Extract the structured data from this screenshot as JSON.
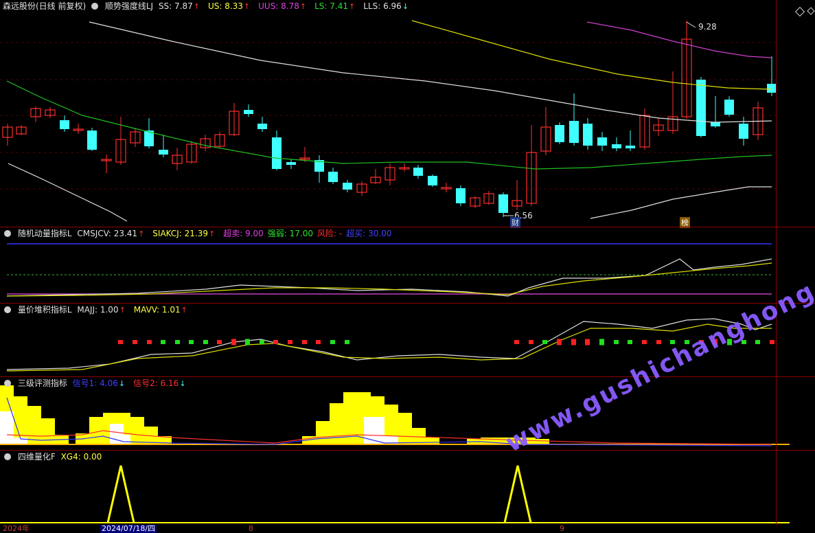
{
  "main": {
    "stock": "森远股份(日线 前复权)",
    "indicator": "顺势强度线LJ",
    "values": [
      {
        "label": "SS: 7.87",
        "arrow": "↑",
        "color": "#e0e0e0",
        "arrow_color": "#ff3030"
      },
      {
        "label": "US: 8.33",
        "arrow": "↑",
        "color": "#ffff40",
        "arrow_color": "#ff3030"
      },
      {
        "label": "UUS: 8.78",
        "arrow": "↑",
        "color": "#e040e0",
        "arrow_color": "#ff3030"
      },
      {
        "label": "LS: 7.41",
        "arrow": "↑",
        "color": "#30e030",
        "arrow_color": "#ff3030"
      },
      {
        "label": "LLS: 6.96",
        "arrow": "↓",
        "color": "#e0e0e0",
        "arrow_color": "#40ffff"
      }
    ],
    "high_label": "9.28",
    "low_label": "6.56",
    "tag_cai": "财",
    "tag_bang": "榜"
  },
  "p2": {
    "name": "随机动量指标L",
    "values": [
      {
        "label": "CMSJCV: 23.41",
        "arrow": "↑",
        "color": "#e0e0e0",
        "arrow_color": "#ff3030"
      },
      {
        "label": "SIAKCJ: 21.39",
        "arrow": "↑",
        "color": "#ffff40",
        "arrow_color": "#ff3030"
      },
      {
        "label": "超卖: 9.00",
        "arrow": "",
        "color": "#e040e0",
        "arrow_color": ""
      },
      {
        "label": "强弱: 17.00",
        "arrow": "",
        "color": "#30e030",
        "arrow_color": ""
      },
      {
        "label": "风险: -",
        "arrow": "",
        "color": "#ff3030",
        "arrow_color": ""
      },
      {
        "label": "超买: 30.00",
        "arrow": "",
        "color": "#4040ff",
        "arrow_color": ""
      }
    ]
  },
  "p3": {
    "name": "量价堆积指标L",
    "values": [
      {
        "label": "MAJJ: 1.00",
        "arrow": "↑",
        "color": "#e0e0e0",
        "arrow_color": "#ff3030"
      },
      {
        "label": "MAVV: 1.01",
        "arrow": "↑",
        "color": "#ffff40",
        "arrow_color": "#ff3030"
      }
    ]
  },
  "p4": {
    "name": "三级评测指标",
    "values": [
      {
        "label": "信号1: 4.06",
        "arrow": "↓",
        "color": "#4040ff",
        "arrow_color": "#40ffff"
      },
      {
        "label": "信号2: 6.16",
        "arrow": "↓",
        "color": "#ff3030",
        "arrow_color": "#40ffff"
      }
    ]
  },
  "p5": {
    "name": "四维量化F",
    "values": [
      {
        "label": "XG4: 0.00",
        "arrow": "",
        "color": "#ffff40",
        "arrow_color": ""
      }
    ]
  },
  "axis": {
    "year": "2024年",
    "selected": "2024/07/18/四",
    "month8": "8",
    "month9": "9"
  },
  "watermark": "www.gushichanghong.com"
}
